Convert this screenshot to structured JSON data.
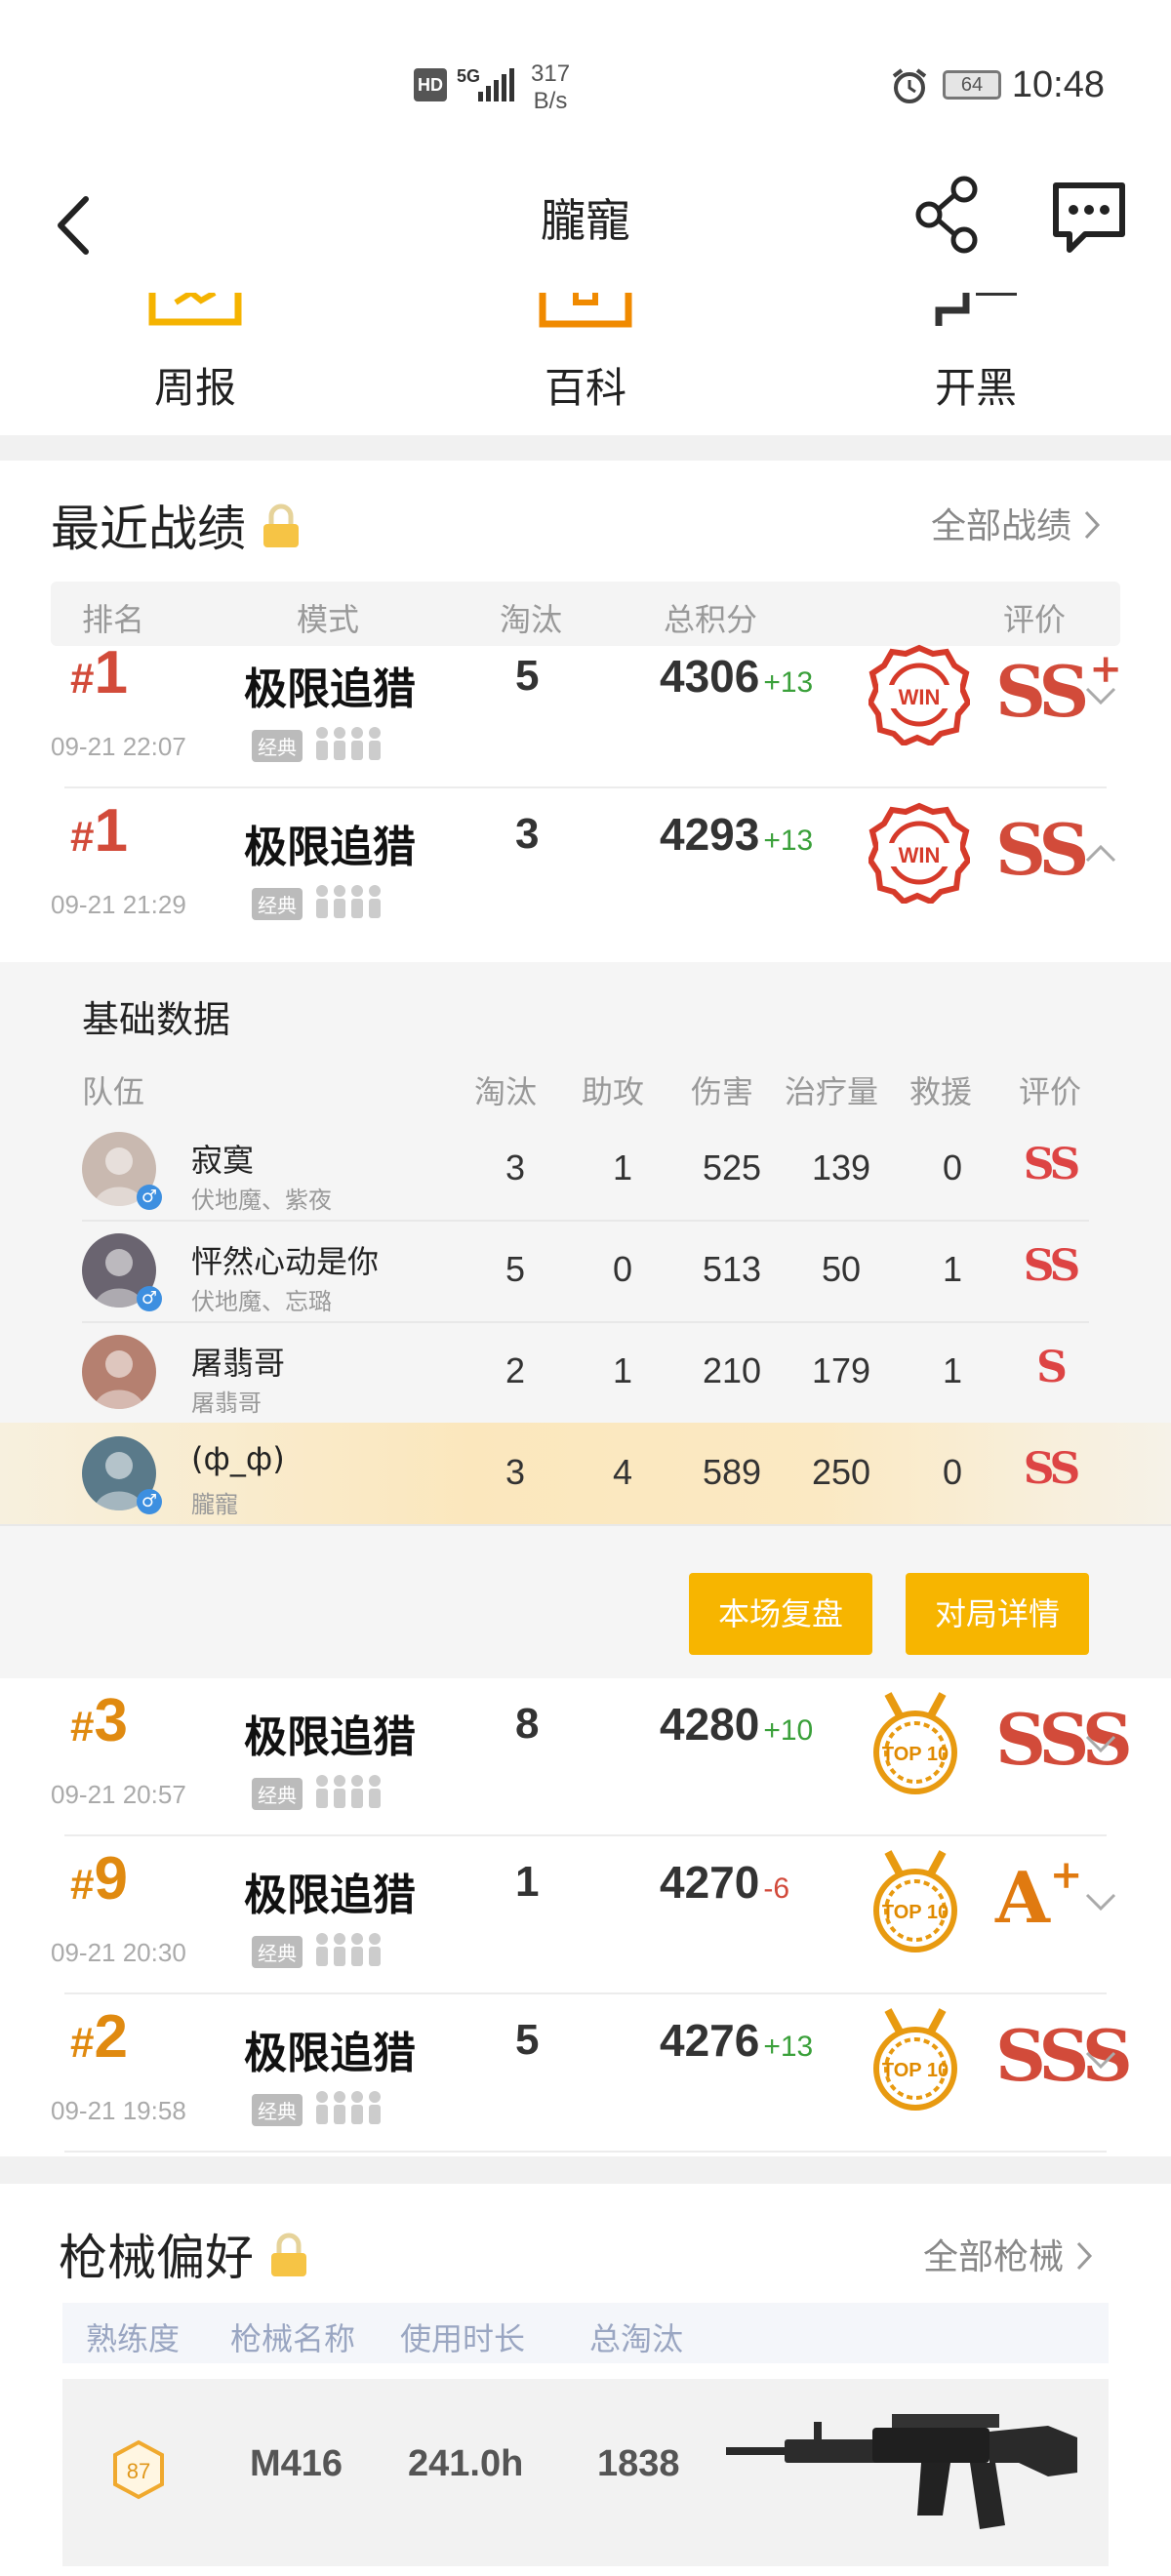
{
  "status_bar": {
    "net_type": "HD",
    "net_gen": "5G",
    "speed_value": "317",
    "speed_unit": "B/s",
    "battery": "64",
    "time": "10:48"
  },
  "header": {
    "title": "朧寵",
    "back_icon": "chevron-left-icon",
    "share_icon": "share-icon",
    "chat_icon": "message-icon"
  },
  "shortcuts": [
    {
      "label": "周报",
      "icon": "weekly-report-icon",
      "color": "#f5b300"
    },
    {
      "label": "百科",
      "icon": "encyclopedia-icon",
      "color": "#f08a00"
    },
    {
      "label": "开黑",
      "icon": "team-up-icon",
      "color": "#333333"
    }
  ],
  "recent": {
    "title": "最近战绩",
    "all_link": "全部战绩",
    "columns": [
      "排名",
      "模式",
      "淘汰",
      "总积分",
      "评价"
    ]
  },
  "matches": [
    {
      "rank": "1",
      "time": "09-21 22:07",
      "mode": "极限追猎",
      "tag": "经典",
      "kills": "5",
      "score": "4306",
      "delta": "+13",
      "delta_color": "#3aa03a",
      "badge": "WIN",
      "rating": "SS",
      "plus": "+",
      "rating_color": "#d24b3a",
      "expanded": false
    },
    {
      "rank": "1",
      "time": "09-21 21:29",
      "mode": "极限追猎",
      "tag": "经典",
      "kills": "3",
      "score": "4293",
      "delta": "+13",
      "delta_color": "#3aa03a",
      "badge": "WIN",
      "rating": "SS",
      "plus": "",
      "rating_color": "#d24b3a",
      "expanded": true
    },
    {
      "rank": "3",
      "time": "09-21 20:57",
      "mode": "极限追猎",
      "tag": "经典",
      "kills": "8",
      "score": "4280",
      "delta": "+10",
      "delta_color": "#3aa03a",
      "badge": "TOP 10",
      "rating": "SSS",
      "plus": "",
      "rating_color": "#d24b3a",
      "expanded": false
    },
    {
      "rank": "9",
      "time": "09-21 20:30",
      "mode": "极限追猎",
      "tag": "经典",
      "kills": "1",
      "score": "4270",
      "delta": "-6",
      "delta_color": "#d2493a",
      "badge": "TOP 10",
      "rating": "A",
      "plus": "+",
      "rating_color": "#e07a10",
      "expanded": false
    },
    {
      "rank": "2",
      "time": "09-21 19:58",
      "mode": "极限追猎",
      "tag": "经典",
      "kills": "5",
      "score": "4276",
      "delta": "+13",
      "delta_color": "#3aa03a",
      "badge": "TOP 10",
      "rating": "SSS",
      "plus": "",
      "rating_color": "#d24b3a",
      "expanded": false
    }
  ],
  "detail": {
    "title": "基础数据",
    "columns": [
      "队伍",
      "淘汰",
      "助攻",
      "伤害",
      "治疗量",
      "救援",
      "评价"
    ],
    "players": [
      {
        "name": "寂寞",
        "nick": "伏地魔、紫夜",
        "kills": "3",
        "assists": "1",
        "damage": "525",
        "heal": "139",
        "rescue": "0",
        "rating": "SS",
        "gender": "♂",
        "avatar_color": "#c9b9b0",
        "highlight": false
      },
      {
        "name": "怦然心动是你",
        "nick": "伏地魔、忘璐",
        "kills": "5",
        "assists": "0",
        "damage": "513",
        "heal": "50",
        "rescue": "1",
        "rating": "SS",
        "gender": "♂",
        "avatar_color": "#6a6470",
        "highlight": false
      },
      {
        "name": "屠翡哥",
        "nick": "屠翡哥",
        "kills": "2",
        "assists": "1",
        "damage": "210",
        "heal": "179",
        "rescue": "1",
        "rating": "S",
        "gender": "",
        "avatar_color": "#b58070",
        "highlight": false
      },
      {
        "name": "(ф_ф)",
        "nick": "朧寵",
        "kills": "3",
        "assists": "4",
        "damage": "589",
        "heal": "250",
        "rescue": "0",
        "rating": "SS",
        "gender": "♂",
        "avatar_color": "#5a7a8a",
        "highlight": true
      }
    ],
    "replay_button": "本场复盘",
    "details_button": "对局详情"
  },
  "weapons": {
    "title": "枪械偏好",
    "all_link": "全部枪械",
    "columns": [
      "熟练度",
      "枪械名称",
      "使用时长",
      "总淘汰"
    ],
    "items": [
      {
        "level": "87",
        "name": "M416",
        "hours": "241.0h",
        "kills": "1838",
        "image_icon": "rifle-icon"
      }
    ]
  }
}
